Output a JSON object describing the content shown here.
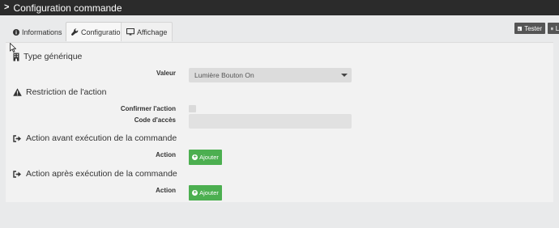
{
  "header": {
    "title": "Configuration commande"
  },
  "tabs": [
    {
      "label": "Informations",
      "icon": "info-circle-icon"
    },
    {
      "label": "Configuration",
      "icon": "wrench-icon",
      "active": true
    },
    {
      "label": "Affichage",
      "icon": "monitor-icon"
    }
  ],
  "toolbar": {
    "tester_label": "Tester",
    "li_label": "Li"
  },
  "type_generique": {
    "title": "Type générique",
    "valeur_label": "Valeur",
    "valeur_value": "Lumière Bouton On"
  },
  "restriction": {
    "title": "Restriction de l'action",
    "confirmer_label": "Confirmer l'action",
    "code_label": "Code d'accès",
    "code_value": ""
  },
  "action_avant": {
    "title": "Action avant exécution de la commande",
    "action_label": "Action",
    "ajouter_label": "Ajouter"
  },
  "action_apres": {
    "title": "Action après exécution de la commande",
    "action_label": "Action",
    "ajouter_label": "Ajouter"
  },
  "colors": {
    "titlebar": "#2b2b2b",
    "panel": "#f2f2f2",
    "green_button": "#4caf50",
    "dark_button": "#555555"
  }
}
